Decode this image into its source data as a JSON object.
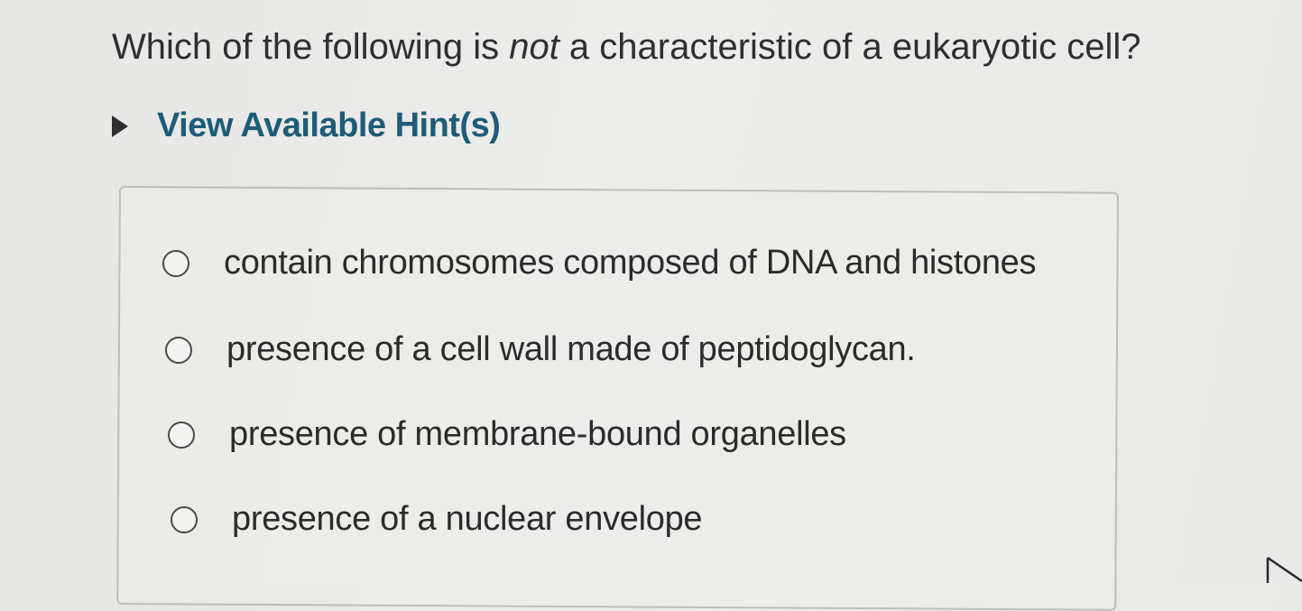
{
  "question": {
    "prefix": "Which of the following is ",
    "emphasis": "not",
    "suffix": " a characteristic of a eukaryotic cell?"
  },
  "hint": {
    "label": "View Available Hint(s)",
    "arrow_icon": "triangle-right-icon",
    "color": "#1e5c78"
  },
  "options": [
    {
      "label": "contain chromosomes composed of DNA and histones",
      "selected": false
    },
    {
      "label": "presence of a cell wall made of peptidoglycan.",
      "selected": false
    },
    {
      "label": "presence of membrane-bound organelles",
      "selected": false
    },
    {
      "label": "presence of a nuclear envelope",
      "selected": false
    }
  ],
  "cursor_icon": "mouse-pointer-icon"
}
